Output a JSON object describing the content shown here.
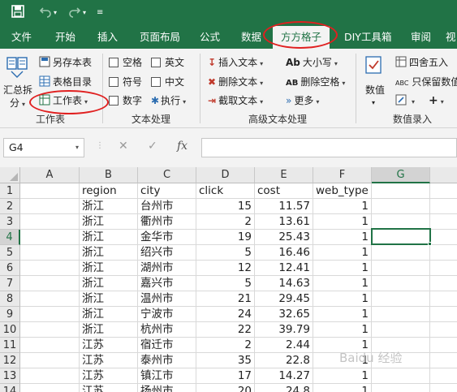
{
  "titlebar": {
    "save_icon": "save-icon",
    "undo_icon": "undo-icon",
    "redo_icon": "redo-icon",
    "customize_icon": "customize-icon"
  },
  "tabs": [
    {
      "label": "文件"
    },
    {
      "label": "开始"
    },
    {
      "label": "插入"
    },
    {
      "label": "页面布局"
    },
    {
      "label": "公式"
    },
    {
      "label": "数据"
    },
    {
      "label": "方方格子"
    },
    {
      "label": "DIY工具箱"
    },
    {
      "label": "审阅"
    },
    {
      "label": "视"
    }
  ],
  "ribbon": {
    "worksheet_group": {
      "summarize_split": "汇总拆",
      "summarize_split_2": "分",
      "save_as": "另存本表",
      "sheet_toc": "表格目录",
      "worksheet": "工作表",
      "label": "工作表"
    },
    "text_group": {
      "space": "空格",
      "english": "英文",
      "symbol": "符号",
      "chinese": "中文",
      "number": "数字",
      "execute": "执行",
      "label": "文本处理"
    },
    "advanced_group": {
      "insert_text": "插入文本",
      "case": "大小写",
      "delete_text": "删除文本",
      "delete_spaces": "删除空格",
      "extract_text": "截取文本",
      "more": "更多",
      "label": "高级文本处理"
    },
    "numeric_group": {
      "value": "数值",
      "round": "四舍五入",
      "keep_value": "只保留数值",
      "plus": "+",
      "label": "数值录入"
    }
  },
  "formula_bar": {
    "name_box": "G4",
    "cancel": "✕",
    "enter": "✓",
    "fx": "fx",
    "formula": ""
  },
  "sheet": {
    "columns": [
      "A",
      "B",
      "C",
      "D",
      "E",
      "F",
      "G"
    ],
    "selected_cell": "G4",
    "rows": [
      {
        "n": "1",
        "A": "",
        "B": "region",
        "C": "city",
        "D": "click",
        "E": "cost",
        "F": "web_type"
      },
      {
        "n": "2",
        "A": "",
        "B": "浙江",
        "C": "台州市",
        "D": "15",
        "E": "11.57",
        "F": "1"
      },
      {
        "n": "3",
        "A": "",
        "B": "浙江",
        "C": "衢州市",
        "D": "2",
        "E": "13.61",
        "F": "1"
      },
      {
        "n": "4",
        "A": "",
        "B": "浙江",
        "C": "金华市",
        "D": "19",
        "E": "25.43",
        "F": "1"
      },
      {
        "n": "5",
        "A": "",
        "B": "浙江",
        "C": "绍兴市",
        "D": "5",
        "E": "16.46",
        "F": "1"
      },
      {
        "n": "6",
        "A": "",
        "B": "浙江",
        "C": "湖州市",
        "D": "12",
        "E": "12.41",
        "F": "1"
      },
      {
        "n": "7",
        "A": "",
        "B": "浙江",
        "C": "嘉兴市",
        "D": "5",
        "E": "14.63",
        "F": "1"
      },
      {
        "n": "8",
        "A": "",
        "B": "浙江",
        "C": "温州市",
        "D": "21",
        "E": "29.45",
        "F": "1"
      },
      {
        "n": "9",
        "A": "",
        "B": "浙江",
        "C": "宁波市",
        "D": "24",
        "E": "32.65",
        "F": "1"
      },
      {
        "n": "10",
        "A": "",
        "B": "浙江",
        "C": "杭州市",
        "D": "22",
        "E": "39.79",
        "F": "1"
      },
      {
        "n": "11",
        "A": "",
        "B": "江苏",
        "C": "宿迁市",
        "D": "2",
        "E": "2.44",
        "F": "1"
      },
      {
        "n": "12",
        "A": "",
        "B": "江苏",
        "C": "泰州市",
        "D": "35",
        "E": "22.8",
        "F": "1"
      },
      {
        "n": "13",
        "A": "",
        "B": "江苏",
        "C": "镇江市",
        "D": "17",
        "E": "14.27",
        "F": "1"
      },
      {
        "n": "14",
        "A": "",
        "B": "江苏",
        "C": "扬州市",
        "D": "20",
        "E": "24.8",
        "F": "1"
      }
    ]
  },
  "watermark": "Baidu 经验",
  "colors": {
    "excel_green": "#217346",
    "highlight_red": "#e02020"
  }
}
